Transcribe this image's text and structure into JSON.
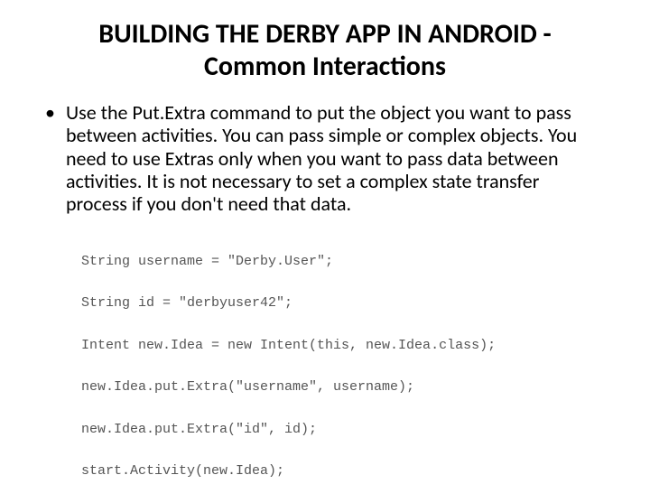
{
  "title": "BUILDING THE DERBY APP IN ANDROID - Common Interactions",
  "bullet": {
    "marker": "•",
    "text": "Use the Put.Extra command to put the object you want to pass between activities. You can pass simple or complex objects. You need to use Extras only when you want to pass data between activities. It is not necessary to set a complex state transfer process if you don't need that data."
  },
  "code": {
    "line1": "String username = \"Derby.User\";",
    "line2": "String id = \"derbyuser42\";",
    "line3": "Intent new.Idea = new Intent(this, new.Idea.class);",
    "line4": "new.Idea.put.Extra(\"username\", username);",
    "line5": "new.Idea.put.Extra(\"id\", id);",
    "line6": "start.Activity(new.Idea);"
  }
}
